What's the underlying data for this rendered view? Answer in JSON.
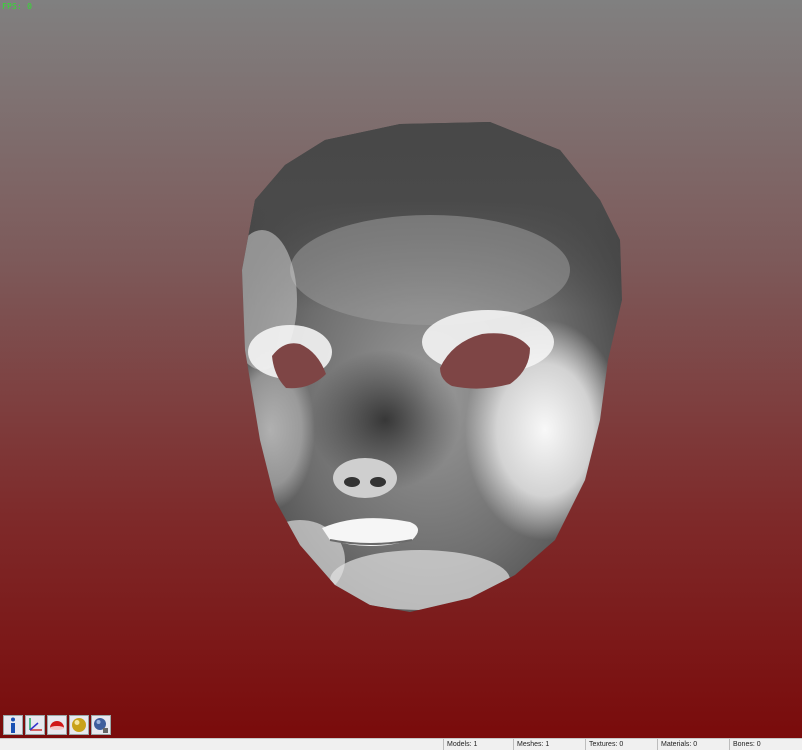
{
  "viewport": {
    "fps_text": "FPS: 0",
    "background_gradient": [
      "#808080",
      "#7d5a5a",
      "#7e2a2a",
      "#7a0b0b"
    ]
  },
  "toolbar": {
    "buttons": [
      {
        "name": "info-icon"
      },
      {
        "name": "axes-icon"
      },
      {
        "name": "hemisphere-icon"
      },
      {
        "name": "sphere-icon"
      },
      {
        "name": "globe-icon"
      }
    ]
  },
  "statusbar": {
    "models": "Models: 1",
    "meshes": "Meshes: 1",
    "textures": "Textures: 0",
    "materials": "Materials: 0",
    "bones": "Bones: 0"
  }
}
